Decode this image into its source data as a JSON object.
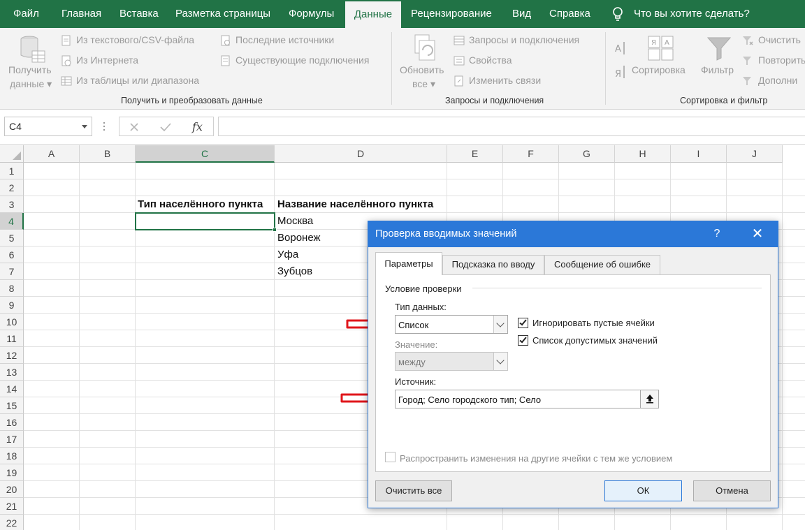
{
  "ribbon_tabs": [
    {
      "label": "Файл"
    },
    {
      "label": "Главная"
    },
    {
      "label": "Вставка"
    },
    {
      "label": "Разметка страницы"
    },
    {
      "label": "Формулы"
    },
    {
      "label": "Данные"
    },
    {
      "label": "Рецензирование"
    },
    {
      "label": "Вид"
    },
    {
      "label": "Справка"
    }
  ],
  "active_tab": "Данные",
  "tell_me": "Что вы хотите сделать?",
  "ribbon": {
    "get_data_line1": "Получить",
    "get_data_line2": "данные",
    "from_csv": "Из текстового/CSV-файла",
    "from_web": "Из Интернета",
    "from_table": "Из таблицы или диапазона",
    "recent_sources": "Последние источники",
    "existing_connections": "Существующие подключения",
    "group1_label": "Получить и преобразовать данные",
    "refresh_line1": "Обновить",
    "refresh_line2": "все",
    "queries_connections": "Запросы и подключения",
    "properties": "Свойства",
    "edit_links": "Изменить связи",
    "group2_label": "Запросы и подключения",
    "sort": "Сортировка",
    "filter": "Фильтр",
    "clear": "Очистить",
    "reapply": "Повторить",
    "advanced": "Дополни",
    "group3_label": "Сортировка и фильтр"
  },
  "formula_bar": {
    "name_box": "C4",
    "fx_label": "fx",
    "formula": ""
  },
  "grid": {
    "columns": [
      "A",
      "B",
      "C",
      "D",
      "E",
      "F",
      "G",
      "H",
      "I",
      "J"
    ],
    "selected_column": "C",
    "rows": [
      "1",
      "2",
      "3",
      "4",
      "5",
      "6",
      "7",
      "8",
      "9",
      "10",
      "11",
      "12",
      "13",
      "14",
      "15",
      "16",
      "17",
      "18",
      "19",
      "20",
      "21",
      "22"
    ],
    "selected_row": "4",
    "cells": {
      "C3": "Тип населённого пункта",
      "D3": "Название населённого пункта",
      "D4": "Москва",
      "D5": "Воронеж",
      "D6": "Уфа",
      "D7": "Зубцов"
    }
  },
  "dialog": {
    "title": "Проверка вводимых значений",
    "help": "?",
    "close": "✕",
    "tabs": [
      {
        "label": "Параметры"
      },
      {
        "label": "Подсказка по вводу"
      },
      {
        "label": "Сообщение об ошибке"
      }
    ],
    "active_tab": "Параметры",
    "condition_header": "Условие проверки",
    "data_type_label": "Тип данных:",
    "data_type_value": "Список",
    "ignore_blank": "Игнорировать пустые ячейки",
    "ignore_blank_checked": true,
    "in_cell_dropdown": "Список допустимых значений",
    "in_cell_dropdown_checked": true,
    "value_label": "Значение:",
    "value_value": "между",
    "source_label": "Источник:",
    "source_value": "Город; Село городского тип; Село",
    "apply_all": "Распространить изменения на другие ячейки с тем же условием",
    "apply_all_checked": false,
    "clear_all": "Очистить все",
    "ok": "ОК",
    "cancel": "Отмена"
  },
  "colors": {
    "excel_green": "#217346",
    "dialog_blue": "#2b78d8",
    "annotation_red": "#e0161b"
  }
}
